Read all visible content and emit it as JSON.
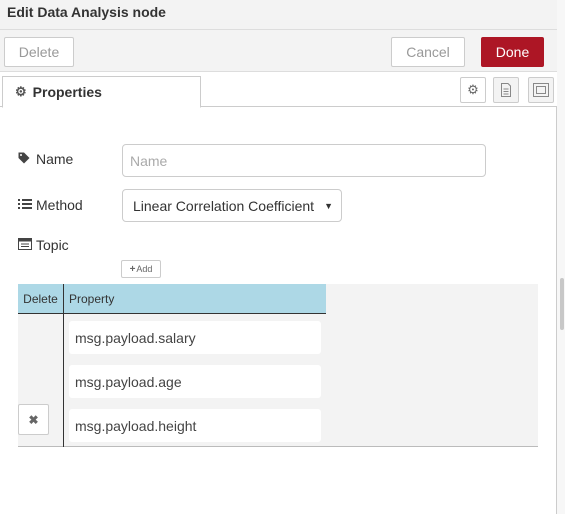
{
  "dialog": {
    "title": "Edit Data Analysis node"
  },
  "toolbar": {
    "delete_label": "Delete",
    "cancel_label": "Cancel",
    "done_label": "Done"
  },
  "tabs": {
    "properties_label": "Properties"
  },
  "icons": {
    "properties_tab": "gear-icon",
    "settings_tab": "gear-icon",
    "description_tab": "document-icon",
    "appearance_tab": "frame-icon",
    "name": "tag-icon",
    "method": "list-icon",
    "topic": "topic-icon",
    "add": "plus-icon",
    "remove": "close-icon"
  },
  "form": {
    "name_label": "Name",
    "name_placeholder": "Name",
    "name_value": "",
    "method_label": "Method",
    "method_value": "Linear Correlation Coefficient",
    "topic_label": "Topic",
    "add_label": "Add"
  },
  "table": {
    "headers": {
      "delete": "Delete",
      "property": "Property"
    },
    "rows": [
      "msg.payload.salary",
      "msg.payload.age",
      "msg.payload.height"
    ]
  },
  "colors": {
    "done_button": "#ad1625",
    "table_header": "#add8e6"
  }
}
